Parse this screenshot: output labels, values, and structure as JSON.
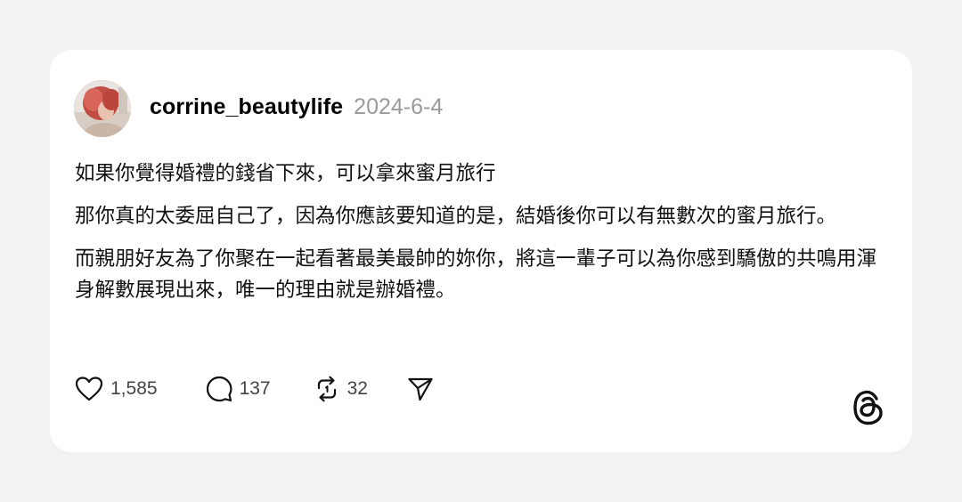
{
  "post": {
    "username": "corrine_beautylife",
    "date": "2024-6-4",
    "paragraphs": [
      "如果你覺得婚禮的錢省下來，可以拿來蜜月旅行",
      "那你真的太委屈自己了，因為你應該要知道的是，結婚後你可以有無數次的蜜月旅行。",
      "而親朋好友為了你聚在一起看著最美最帥的妳你，將這一輩子可以為你感到驕傲的共鳴用渾身解數展現出來，唯一的理由就是辦婚禮。"
    ]
  },
  "actions": {
    "likes": "1,585",
    "replies": "137",
    "reposts": "32"
  },
  "icons": {
    "like": "heart-icon",
    "reply": "speech-bubble-icon",
    "repost": "repost-icon",
    "share": "send-icon",
    "brand": "threads-logo-icon"
  },
  "colors": {
    "page_background": "#f2f2f2",
    "card_background": "#ffffff",
    "text": "#111111",
    "date": "#9a9a9a"
  }
}
